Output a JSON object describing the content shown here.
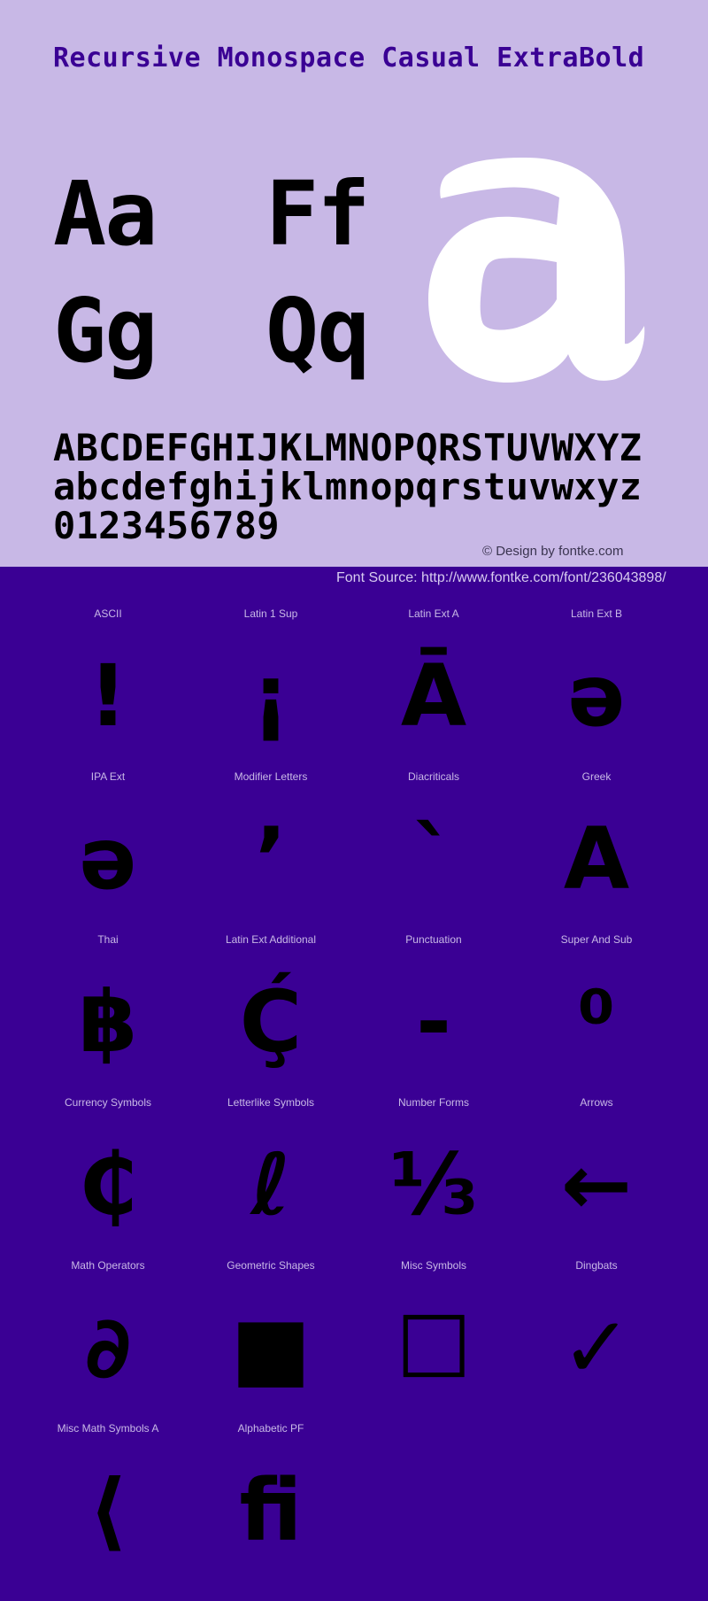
{
  "header": {
    "title": "Recursive Monospace Casual ExtraBold"
  },
  "samples": {
    "pairs": [
      "Aa",
      "Ff",
      "Gg",
      "Qq"
    ],
    "big_glyph": "a"
  },
  "alphabet": {
    "uppercase": "ABCDEFGHIJKLMNOPQRSTUVWXYZ",
    "lowercase": "abcdefghijklmnopqrstuvwxyz",
    "digits": "0123456789"
  },
  "credit": "© Design by fontke.com",
  "font_source": "Font Source: http://www.fontke.com/font/236043898/",
  "colors": {
    "light_bg": "#c8b8e6",
    "dark_bg": "#3a0094",
    "glyph": "#000000",
    "big_glyph": "#ffffff"
  },
  "blocks": [
    {
      "label": "ASCII",
      "glyph": "!"
    },
    {
      "label": "Latin 1 Sup",
      "glyph": "¡"
    },
    {
      "label": "Latin Ext A",
      "glyph": "Ā"
    },
    {
      "label": "Latin Ext B",
      "glyph": "ə"
    },
    {
      "label": "IPA Ext",
      "glyph": "ə"
    },
    {
      "label": "Modifier Letters",
      "glyph": "ʼ"
    },
    {
      "label": "Diacriticals",
      "glyph": "ˋ"
    },
    {
      "label": "Greek",
      "glyph": "Α"
    },
    {
      "label": "Thai",
      "glyph": "฿"
    },
    {
      "label": "Latin Ext Additional",
      "glyph": "Ḉ"
    },
    {
      "label": "Punctuation",
      "glyph": "‐"
    },
    {
      "label": "Super And Sub",
      "glyph": "⁰"
    },
    {
      "label": "Currency Symbols",
      "glyph": "₵"
    },
    {
      "label": "Letterlike Symbols",
      "glyph": "ℓ"
    },
    {
      "label": "Number Forms",
      "glyph": "⅓"
    },
    {
      "label": "Arrows",
      "glyph": "←"
    },
    {
      "label": "Math Operators",
      "glyph": "∂"
    },
    {
      "label": "Geometric Shapes",
      "glyph": "■"
    },
    {
      "label": "Misc Symbols",
      "glyph": "☐"
    },
    {
      "label": "Dingbats",
      "glyph": "✓"
    },
    {
      "label": "Misc Math Symbols A",
      "glyph": "⟨"
    },
    {
      "label": "Alphabetic PF",
      "glyph": "ﬁ"
    }
  ]
}
